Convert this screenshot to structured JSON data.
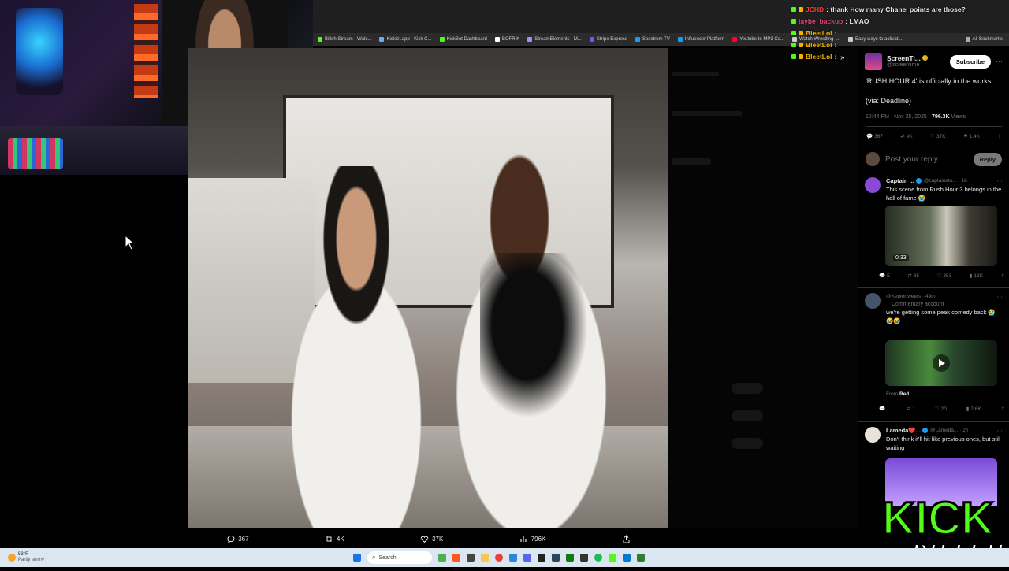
{
  "chat": {
    "lines": [
      {
        "user": "JCHD",
        "user_color": "#ff3b3b",
        "message": "thank How many Chanel points are those?"
      },
      {
        "user": "jaybe_backup",
        "user_color": "#e0466e",
        "message": "LMAO"
      },
      {
        "user": "BleetLol",
        "user_color": "#f5b400",
        "message": ""
      },
      {
        "user": "BleetLol",
        "user_color": "#f5b400",
        "message": ""
      },
      {
        "user": "BleetLol",
        "user_color": "#f5b400",
        "message": ""
      }
    ]
  },
  "bookmarks": [
    "Billeh Stream - Watc...",
    "Kickiet.app - Kick C...",
    "KickBot Dashboard",
    "BOFRIK",
    "StreamElements - M...",
    "Stripe Express",
    "Spectrum TV",
    "Influencer Platform",
    "Youtube to MP3 Co...",
    "Watch Wrestling -...",
    "Easy ways to activat...",
    "All Bookmarks"
  ],
  "main_actions": {
    "replies": "367",
    "reposts": "4K",
    "likes": "37K",
    "views": "796K"
  },
  "tweet": {
    "author": "ScreenTi...",
    "handle": "@screentime",
    "subscribe_label": "Subscribe",
    "line1": "'RUSH HOUR 4' is officially in the works",
    "line2": "(via: Deadline)",
    "meta": "12:44 PM · Nov 25, 2025 · ",
    "views_count": "796.3K",
    "views_label": " Views",
    "stats": {
      "replies": "367",
      "reposts": "4K",
      "likes": "37K",
      "bookmarks": "1.4K"
    },
    "reply_placeholder": "Post your reply",
    "reply_button": "Reply"
  },
  "replies": [
    {
      "author": "Captain ...",
      "handle": "@captainato... · 1h",
      "text": "This scene from Rush Hour 3 belongs in the hall of fame 😭",
      "video_time": "0:33",
      "stats": {
        "replies": "5",
        "reposts": "35",
        "likes": "353",
        "views": "13K"
      }
    },
    {
      "author": "",
      "handle": "@Keplertweets · 49m",
      "label": "Commentary account",
      "text": "we're getting some peak comedy back 😭😭😭",
      "from_label": "From ",
      "from_name": "Red",
      "stats": {
        "replies": "",
        "reposts": "1",
        "likes": "20",
        "views": "2.6K"
      }
    },
    {
      "author": "Lameda❤️...",
      "handle": "@Lameda... · 2h",
      "text": "Don't think it'll hit like previous ones, but still waiting"
    }
  ],
  "taskbar": {
    "weather_temp": "53°F",
    "weather_text": "Partly sunny",
    "search_placeholder": "Search"
  },
  "overlay": {
    "logo_text": "KICK",
    "signature": "BILLEH"
  },
  "colors": {
    "accent": "#1d9bf0",
    "kick_green": "#53fc18"
  }
}
